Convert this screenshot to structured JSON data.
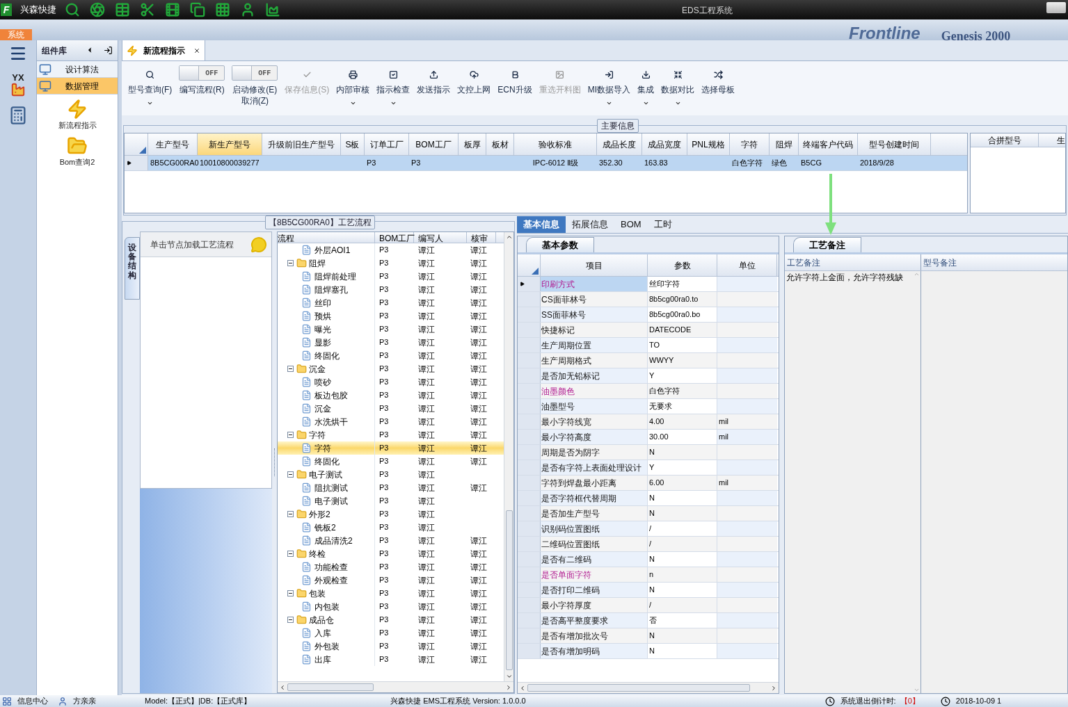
{
  "title": "EDS工程系统",
  "logo_letter": "F",
  "app_name": "兴森快捷",
  "menu_tab": "系统",
  "backdrop_texts": [
    "Frontline",
    "Genesis 2000"
  ],
  "rail_badge": "YX",
  "sidebar": {
    "header": "组件库",
    "items": [
      {
        "label": "设计算法",
        "selected": false
      },
      {
        "label": "数据管理",
        "selected": true
      }
    ],
    "launchers": [
      {
        "label": "新流程指示"
      },
      {
        "label": "Bom查询2"
      }
    ]
  },
  "doc_tab": {
    "label": "新流程指示"
  },
  "toolbar": [
    {
      "kind": "button",
      "label": "型号查询(F)",
      "menu": true,
      "disabled": false
    },
    {
      "kind": "toggle",
      "label": "编写流程(R)",
      "toggle_text": "OFF",
      "on": false,
      "menu": false,
      "disabled": false
    },
    {
      "kind": "toggle",
      "label": "启动修改(E)",
      "sub_label": "取消(Z)",
      "toggle_text": "OFF",
      "on": false,
      "menu": false,
      "disabled": false
    },
    {
      "kind": "button",
      "label": "保存信息(S)",
      "menu": false,
      "disabled": true
    },
    {
      "kind": "button",
      "label": "内部审核",
      "menu": true,
      "disabled": false
    },
    {
      "kind": "button",
      "label": "指示检查",
      "menu": true,
      "disabled": false
    },
    {
      "kind": "button",
      "label": "发送指示",
      "menu": false,
      "disabled": false
    },
    {
      "kind": "button",
      "label": "文控上网",
      "menu": false,
      "disabled": false
    },
    {
      "kind": "button",
      "label": "ECN升级",
      "menu": false,
      "disabled": false
    },
    {
      "kind": "button",
      "label": "重选开料图",
      "menu": false,
      "disabled": true
    },
    {
      "kind": "button",
      "label": "MI数据导入",
      "menu": true,
      "disabled": false
    },
    {
      "kind": "button",
      "label": "集成",
      "menu": true,
      "disabled": false
    },
    {
      "kind": "button",
      "label": "数据对比",
      "menu": true,
      "disabled": false
    },
    {
      "kind": "button",
      "label": "选择母板",
      "menu": false,
      "disabled": false
    }
  ],
  "main_info": {
    "legend": "主要信息",
    "columns": [
      {
        "label": "生产型号",
        "selected": false
      },
      {
        "label": "新生产型号",
        "selected": true
      },
      {
        "label": "升级前旧生产型号",
        "selected": false
      },
      {
        "label": "S板",
        "selected": false
      },
      {
        "label": "订单工厂",
        "selected": false
      },
      {
        "label": "BOM工厂",
        "selected": false
      },
      {
        "label": "板厚",
        "selected": false
      },
      {
        "label": "板材",
        "selected": false
      },
      {
        "label": "验收标准",
        "selected": false
      },
      {
        "label": "成品长度",
        "selected": false
      },
      {
        "label": "成品宽度",
        "selected": false
      },
      {
        "label": "PNL规格",
        "selected": false
      },
      {
        "label": "字符",
        "selected": false
      },
      {
        "label": "阻焊",
        "selected": false
      },
      {
        "label": "终端客户代码",
        "selected": false
      },
      {
        "label": "型号创建时间",
        "selected": false
      }
    ],
    "rows": [
      {
        "selected": true,
        "cells": [
          "8B5CG00RA0",
          "10010800039277",
          null,
          null,
          "P3",
          "P3",
          null,
          null,
          "IPC-6012 Ⅱ级",
          "352.30",
          "163.83",
          null,
          "白色字符",
          "绿色",
          "B5CG",
          "2018/9/28"
        ]
      }
    ],
    "side_columns": [
      "合拼型号",
      "生"
    ]
  },
  "flow": {
    "legend": "【8B5CG00RA0】工艺流程",
    "side_tab": "设备结构",
    "hint": "单击节点加载工艺流程",
    "columns": [
      "流程",
      "BOM工厂",
      "编写人",
      "核审"
    ],
    "nodes": [
      {
        "label": "外层AOI1",
        "kind": "leaf",
        "bom": "P3",
        "writer": "谭江",
        "reviewer": "谭江",
        "selected": false
      },
      {
        "label": "阻焊",
        "kind": "folder",
        "expanded": true,
        "bom": "P3",
        "writer": "谭江",
        "reviewer": "谭江",
        "selected": false,
        "children": [
          {
            "label": "阻焊前处理",
            "kind": "leaf",
            "bom": "P3",
            "writer": "谭江",
            "reviewer": "谭江",
            "selected": false
          },
          {
            "label": "阻焊塞孔",
            "kind": "leaf",
            "bom": "P3",
            "writer": "谭江",
            "reviewer": "谭江",
            "selected": false
          },
          {
            "label": "丝印",
            "kind": "leaf",
            "bom": "P3",
            "writer": "谭江",
            "reviewer": "谭江",
            "selected": false
          },
          {
            "label": "预烘",
            "kind": "leaf",
            "bom": "P3",
            "writer": "谭江",
            "reviewer": "谭江",
            "selected": false
          },
          {
            "label": "曝光",
            "kind": "leaf",
            "bom": "P3",
            "writer": "谭江",
            "reviewer": "谭江",
            "selected": false
          },
          {
            "label": "显影",
            "kind": "leaf",
            "bom": "P3",
            "writer": "谭江",
            "reviewer": "谭江",
            "selected": false
          },
          {
            "label": "终固化",
            "kind": "leaf",
            "bom": "P3",
            "writer": "谭江",
            "reviewer": "谭江",
            "selected": false
          }
        ]
      },
      {
        "label": "沉金",
        "kind": "folder",
        "expanded": true,
        "bom": "P3",
        "writer": "谭江",
        "reviewer": "谭江",
        "selected": false,
        "children": [
          {
            "label": "喷砂",
            "kind": "leaf",
            "bom": "P3",
            "writer": "谭江",
            "reviewer": "谭江",
            "selected": false
          },
          {
            "label": "板边包胶",
            "kind": "leaf",
            "bom": "P3",
            "writer": "谭江",
            "reviewer": "谭江",
            "selected": false
          },
          {
            "label": "沉金",
            "kind": "leaf",
            "bom": "P3",
            "writer": "谭江",
            "reviewer": "谭江",
            "selected": false
          },
          {
            "label": "水洗烘干",
            "kind": "leaf",
            "bom": "P3",
            "writer": "谭江",
            "reviewer": "谭江",
            "selected": false
          }
        ]
      },
      {
        "label": "字符",
        "kind": "folder",
        "expanded": true,
        "bom": "P3",
        "writer": "谭江",
        "reviewer": "谭江",
        "selected": false,
        "children": [
          {
            "label": "字符",
            "kind": "leaf",
            "bom": "P3",
            "writer": "谭江",
            "reviewer": "谭江",
            "selected": true
          },
          {
            "label": "终固化",
            "kind": "leaf",
            "bom": "P3",
            "writer": "谭江",
            "reviewer": "谭江",
            "selected": false
          }
        ]
      },
      {
        "label": "电子测试",
        "kind": "folder",
        "expanded": true,
        "bom": "P3",
        "writer": "谭江",
        "selected": false,
        "children": [
          {
            "label": "阻抗测试",
            "kind": "leaf",
            "bom": "P3",
            "writer": "谭江",
            "reviewer": "谭江",
            "selected": false
          },
          {
            "label": "电子测试",
            "kind": "leaf",
            "bom": "P3",
            "writer": "谭江",
            "selected": false
          }
        ]
      },
      {
        "label": "外形2",
        "kind": "folder",
        "expanded": true,
        "bom": "P3",
        "writer": "谭江",
        "selected": false,
        "children": [
          {
            "label": "铣板2",
            "kind": "leaf",
            "bom": "P3",
            "writer": "谭江",
            "selected": false
          },
          {
            "label": "成品清洗2",
            "kind": "leaf",
            "bom": "P3",
            "writer": "谭江",
            "reviewer": "谭江",
            "selected": false
          }
        ]
      },
      {
        "label": "终检",
        "kind": "folder",
        "expanded": true,
        "bom": "P3",
        "writer": "谭江",
        "reviewer": "谭江",
        "selected": false,
        "children": [
          {
            "label": "功能检查",
            "kind": "leaf",
            "bom": "P3",
            "writer": "谭江",
            "reviewer": "谭江",
            "selected": false
          },
          {
            "label": "外观检查",
            "kind": "leaf",
            "bom": "P3",
            "writer": "谭江",
            "reviewer": "谭江",
            "selected": false
          }
        ]
      },
      {
        "label": "包装",
        "kind": "folder",
        "expanded": true,
        "bom": "P3",
        "writer": "谭江",
        "reviewer": "谭江",
        "selected": false,
        "children": [
          {
            "label": "内包装",
            "kind": "leaf",
            "bom": "P3",
            "writer": "谭江",
            "reviewer": "谭江",
            "selected": false
          }
        ]
      },
      {
        "label": "成品仓",
        "kind": "folder",
        "expanded": true,
        "bom": "P3",
        "writer": "谭江",
        "reviewer": "谭江",
        "selected": false,
        "children": [
          {
            "label": "入库",
            "kind": "leaf",
            "bom": "P3",
            "writer": "谭江",
            "reviewer": "谭江",
            "selected": false
          },
          {
            "label": "外包装",
            "kind": "leaf",
            "bom": "P3",
            "writer": "谭江",
            "reviewer": "谭江",
            "selected": false
          },
          {
            "label": "出库",
            "kind": "leaf",
            "bom": "P3",
            "writer": "谭江",
            "reviewer": "谭江",
            "selected": false
          }
        ]
      }
    ]
  },
  "detail_tabs": [
    {
      "label": "基本信息",
      "selected": true
    },
    {
      "label": "拓展信息",
      "selected": false
    },
    {
      "label": "BOM",
      "selected": false
    },
    {
      "label": "工时",
      "selected": false
    }
  ],
  "params": {
    "tab": "基本参数",
    "columns": [
      "项目",
      "参数",
      "单位"
    ],
    "rows": [
      {
        "item": "印刷方式",
        "value": "丝印字符",
        "flagged": true,
        "selected": true
      },
      {
        "item": "CS面菲林号",
        "value": "8b5cg00ra0.to",
        "flagged": false,
        "selected": false
      },
      {
        "item": "SS面菲林号",
        "value": "8b5cg00ra0.bo",
        "flagged": false,
        "selected": false
      },
      {
        "item": "快捷标记",
        "value": "DATECODE",
        "flagged": false,
        "selected": false
      },
      {
        "item": "生产周期位置",
        "value": "TO",
        "flagged": false,
        "selected": false
      },
      {
        "item": "生产周期格式",
        "value": "WWYY",
        "flagged": false,
        "selected": false
      },
      {
        "item": "是否加无铅标记",
        "value": "Y",
        "flagged": false,
        "selected": false
      },
      {
        "item": "油墨颜色",
        "value": "白色字符",
        "flagged": true,
        "selected": false
      },
      {
        "item": "油墨型号",
        "value": "无要求",
        "flagged": false,
        "selected": false
      },
      {
        "item": "最小字符线宽",
        "value": "4.00",
        "unit": "mil",
        "flagged": false,
        "selected": false
      },
      {
        "item": "最小字符高度",
        "value": "30.00",
        "unit": "mil",
        "flagged": false,
        "selected": false
      },
      {
        "item": "周期是否为阴字",
        "value": "N",
        "flagged": false,
        "selected": false
      },
      {
        "item": "是否有字符上表面处理设计",
        "value": "Y",
        "flagged": false,
        "selected": false
      },
      {
        "item": "字符到焊盘最小距离",
        "value": "6.00",
        "unit": "mil",
        "flagged": false,
        "selected": false
      },
      {
        "item": "是否字符框代替周期",
        "value": "N",
        "flagged": false,
        "selected": false
      },
      {
        "item": "是否加生产型号",
        "value": "N",
        "flagged": false,
        "selected": false
      },
      {
        "item": "识别码位置图纸",
        "value": "/",
        "flagged": false,
        "selected": false
      },
      {
        "item": "二维码位置图纸",
        "value": "/",
        "flagged": false,
        "selected": false
      },
      {
        "item": "是否有二维码",
        "value": "N",
        "flagged": false,
        "selected": false
      },
      {
        "item": "是否单面字符",
        "value": "n",
        "flagged": true,
        "selected": false
      },
      {
        "item": "是否打印二维码",
        "value": "N",
        "flagged": false,
        "selected": false
      },
      {
        "item": "最小字符厚度",
        "value": "/",
        "flagged": false,
        "selected": false
      },
      {
        "item": "是否高平整度要求",
        "value": "否",
        "flagged": false,
        "selected": false
      },
      {
        "item": "是否有增加批次号",
        "value": "N",
        "flagged": false,
        "selected": false
      },
      {
        "item": "是否有增加明码",
        "value": "N",
        "flagged": false,
        "selected": false
      }
    ]
  },
  "remarks": {
    "tab": "工艺备注",
    "columns": [
      "工艺备注",
      "型号备注"
    ],
    "text": "允许字符上金面，允许字符残缺"
  },
  "status_bar": {
    "info_center": "信息中心",
    "user": "方亲亲",
    "model_db": "Model:【正式】|DB:【正式库】",
    "version": "兴森快捷 EMS工程系统 Version: 1.0.0.0",
    "countdown_label": "系统退出倒计时:",
    "countdown": "【0】",
    "datetime": "2018-10-09 1"
  }
}
